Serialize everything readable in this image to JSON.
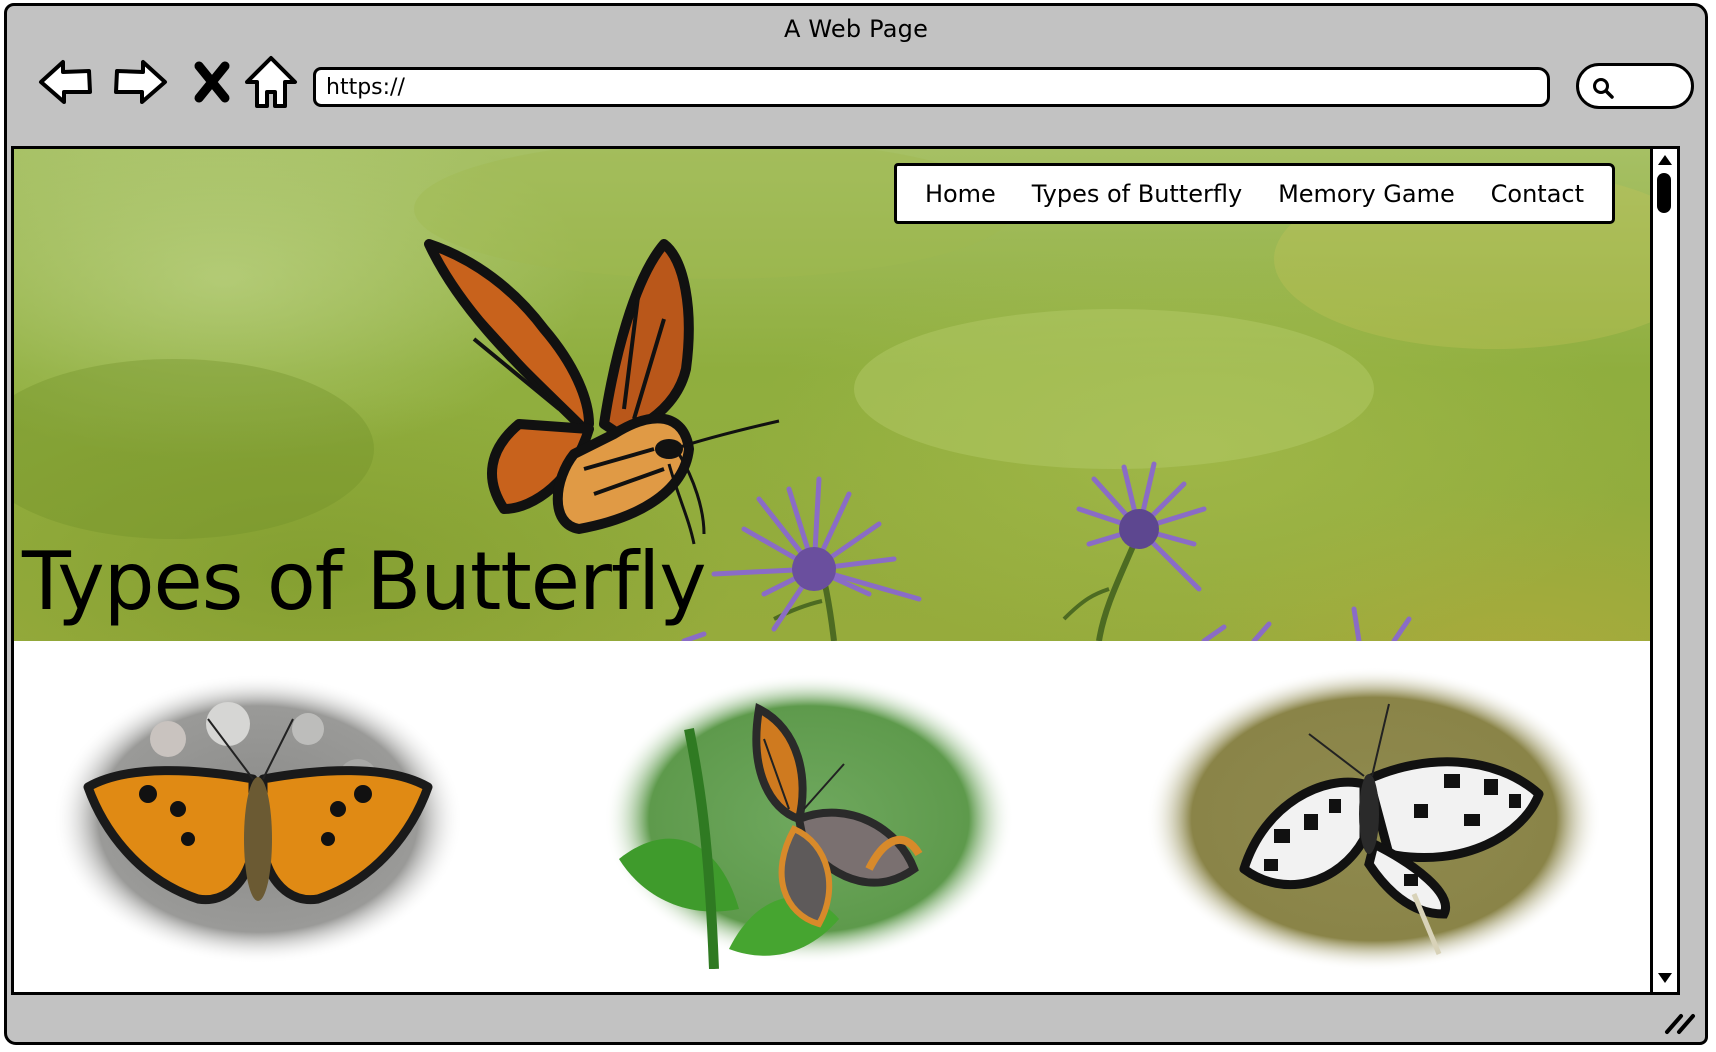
{
  "window": {
    "title": "A Web Page"
  },
  "toolbar": {
    "back_icon": "back-arrow-icon",
    "forward_icon": "forward-arrow-icon",
    "stop_icon": "close-x-icon",
    "home_icon": "home-icon",
    "url_value": "https://",
    "search_icon": "search-icon"
  },
  "page": {
    "hero_title": "Types of Butterfly",
    "nav": [
      {
        "label": "Home"
      },
      {
        "label": "Types of Butterfly"
      },
      {
        "label": "Memory Game"
      },
      {
        "label": "Contact"
      }
    ],
    "gallery": [
      {
        "subject": "small-tortoiseshell-butterfly-photo",
        "backdrop": "grey-stones"
      },
      {
        "subject": "heath-fritillary-butterfly-photo",
        "backdrop": "green-leaves"
      },
      {
        "subject": "marbled-white-butterfly-photo",
        "backdrop": "olive-grass"
      }
    ]
  },
  "colors": {
    "chrome": "#c2c2c2",
    "hero_green": "#96ab3c",
    "monarch_orange": "#c8621c",
    "flower_purple": "#8b6bc4"
  }
}
